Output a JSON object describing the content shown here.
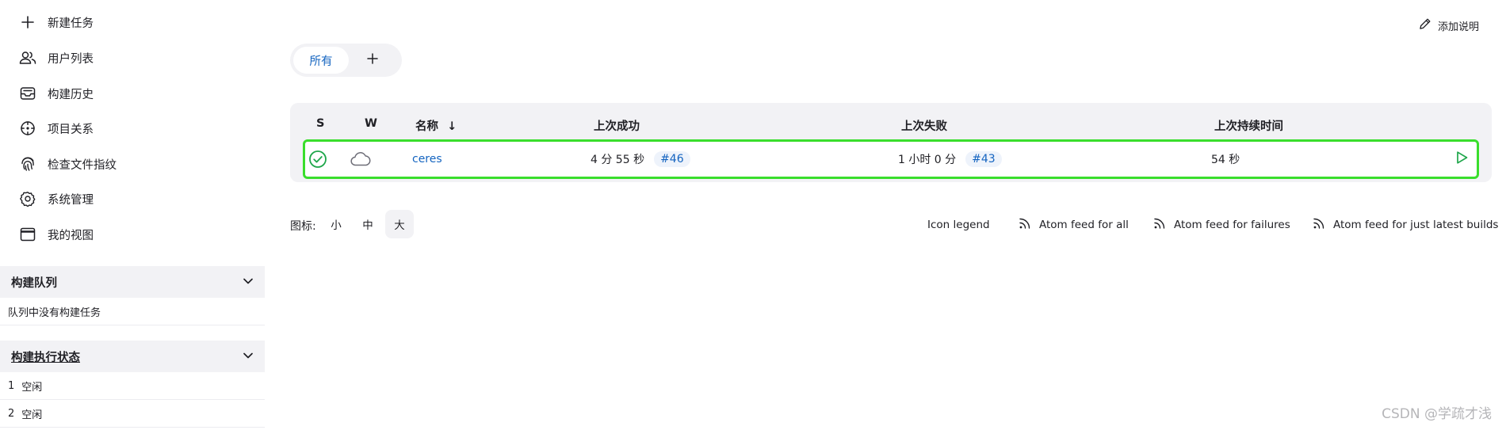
{
  "sidebar": {
    "nav": [
      {
        "label": "新建任务",
        "icon": "plus-icon"
      },
      {
        "label": "用户列表",
        "icon": "users-icon"
      },
      {
        "label": "构建历史",
        "icon": "inbox-icon"
      },
      {
        "label": "项目关系",
        "icon": "crosshair-icon"
      },
      {
        "label": "检查文件指纹",
        "icon": "fingerprint-icon"
      },
      {
        "label": "系统管理",
        "icon": "gear-icon"
      },
      {
        "label": "我的视图",
        "icon": "window-icon"
      }
    ],
    "queue": {
      "title": "构建队列",
      "empty_text": "队列中没有构建任务"
    },
    "executors": {
      "title": "构建执行状态",
      "rows": [
        {
          "num": "1",
          "status": "空闲"
        },
        {
          "num": "2",
          "status": "空闲"
        }
      ]
    }
  },
  "header": {
    "add_description": "添加说明"
  },
  "tabs": {
    "active": "所有",
    "add_symbol": "+"
  },
  "table": {
    "headers": {
      "s": "S",
      "w": "W",
      "name": "名称",
      "sort_arrow": "↓",
      "last_success": "上次成功",
      "last_failure": "上次失败",
      "last_duration": "上次持续时间"
    },
    "rows": [
      {
        "name": "ceres",
        "last_success": "4 分 55 秒",
        "last_success_build": "#46",
        "last_failure": "1 小时 0 分",
        "last_failure_build": "#43",
        "last_duration": "54 秒",
        "status_icon": "success-check-icon",
        "weather_icon": "cloud-icon"
      }
    ]
  },
  "icon_size": {
    "label": "图标:",
    "options": [
      "小",
      "中",
      "大"
    ],
    "selected": "大"
  },
  "footer_links": {
    "legend": "Icon legend",
    "feed_all": "Atom feed for all",
    "feed_failures": "Atom feed for failures",
    "feed_latest": "Atom feed for just latest builds"
  },
  "watermark": "CSDN @学疏才浅",
  "colors": {
    "accent": "#1464c0",
    "success": "#1ea64a",
    "highlight": "#3ade2c",
    "panel_bg": "#f2f2f5"
  }
}
